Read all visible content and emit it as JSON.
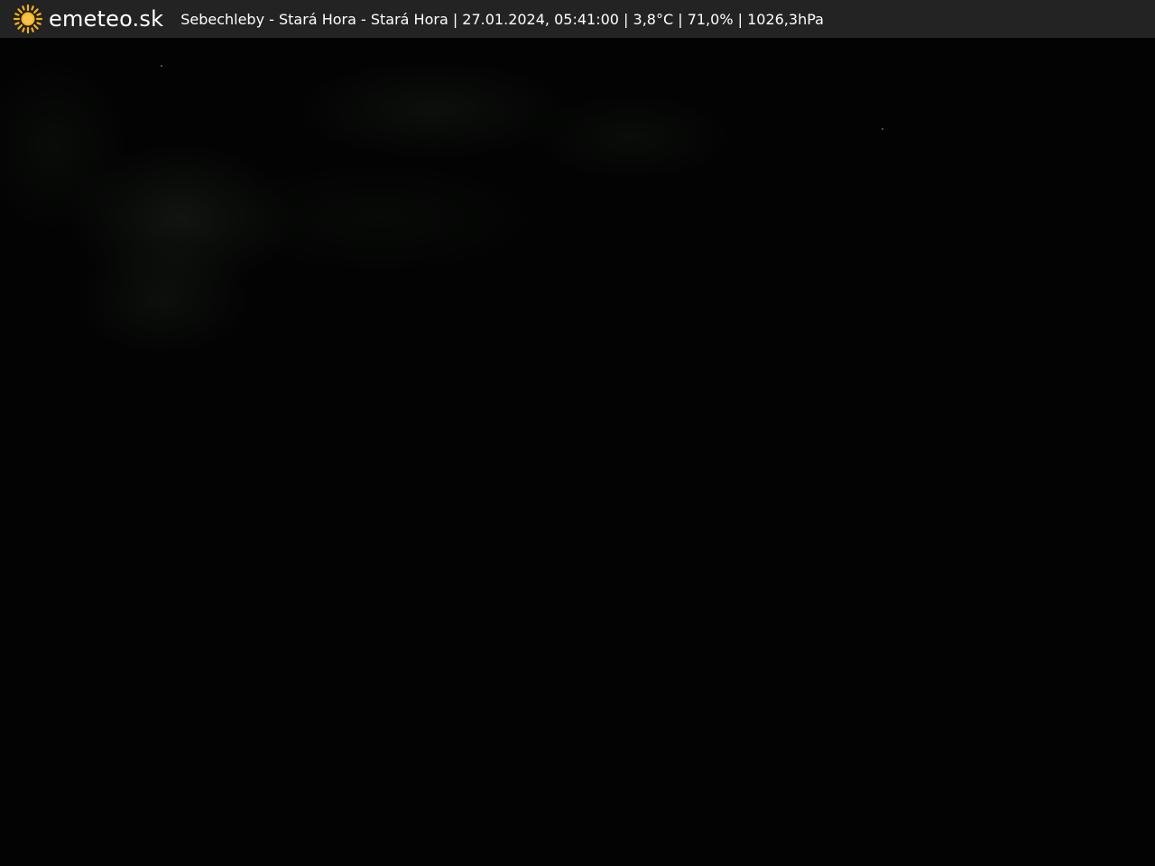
{
  "header": {
    "brand": "emeteo.sk",
    "logo_icon": "sun-icon",
    "caption": "Sebechleby - Stará Hora - Stará Hora | 27.01.2024, 05:41:00 | 3,8°C | 71,0% | 1026,3hPa"
  },
  "colors": {
    "bar_background": "#232323",
    "sun": "#f5b324",
    "text": "#ffffff"
  }
}
